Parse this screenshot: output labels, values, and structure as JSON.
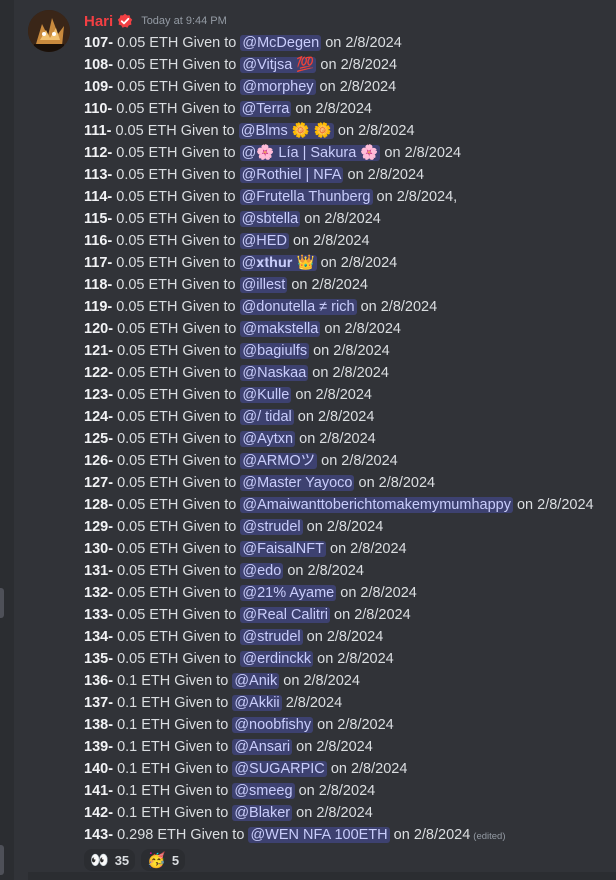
{
  "author": {
    "name": "Hari",
    "timestamp": "Today at 9:44 PM",
    "name_color": "#f23f43",
    "badge": "verified-check-icon"
  },
  "lines": [
    {
      "num": "107-",
      "pre": "0.05 ETH Given to",
      "mention": "@McDegen",
      "post": "on 2/8/2024"
    },
    {
      "num": "108-",
      "pre": "0.05 ETH Given to",
      "mention": "@Vitjsa 💯",
      "post": "on 2/8/2024"
    },
    {
      "num": "109-",
      "pre": "0.05 ETH Given to",
      "mention": "@morphey",
      "post": "on 2/8/2024"
    },
    {
      "num": "110-",
      "pre": "0.05 ETH Given to",
      "mention": "@Terra",
      "post": "on 2/8/2024"
    },
    {
      "num": "111-",
      "pre": "0.05 ETH Given to",
      "mention": "@Blms 🌼 🌼",
      "post": "on 2/8/2024"
    },
    {
      "num": "112-",
      "pre": "0.05 ETH Given to",
      "mention": "@🌸 Lía | Sakura 🌸",
      "post": "on 2/8/2024"
    },
    {
      "num": "113-",
      "pre": "0.05 ETH Given to",
      "mention": "@Rothiel | NFA",
      "post": "on 2/8/2024"
    },
    {
      "num": "114-",
      "pre": "0.05 ETH Given to",
      "mention": "@Frutella Thunberg",
      "post": "on 2/8/2024,"
    },
    {
      "num": "115-",
      "pre": "0.05 ETH Given to",
      "mention": "@sbtella",
      "post": "on 2/8/2024"
    },
    {
      "num": "116-",
      "pre": "0.05 ETH Given to",
      "mention": "@HED",
      "post": "on 2/8/2024"
    },
    {
      "num": "117-",
      "pre": "0.05 ETH Given to",
      "mention": "@𝐱𝐭𝐡𝐮𝐫 👑",
      "post": "on 2/8/2024"
    },
    {
      "num": "118-",
      "pre": "0.05 ETH Given to",
      "mention": "@illest",
      "post": "on 2/8/2024"
    },
    {
      "num": "119-",
      "pre": "0.05 ETH Given to",
      "mention": "@donutella ≠ rich",
      "post": "on 2/8/2024"
    },
    {
      "num": "120-",
      "pre": "0.05 ETH Given to",
      "mention": "@makstella",
      "post": "on 2/8/2024"
    },
    {
      "num": "121-",
      "pre": "0.05 ETH Given to",
      "mention": "@bagiulfs",
      "post": "on 2/8/2024"
    },
    {
      "num": "122-",
      "pre": "0.05 ETH Given to",
      "mention": "@Naskaa",
      "post": "on 2/8/2024"
    },
    {
      "num": "123-",
      "pre": "0.05 ETH Given to",
      "mention": "@Kulle",
      "post": "on 2/8/2024"
    },
    {
      "num": "124-",
      "pre": "0.05 ETH Given to",
      "mention": "@/ tidal",
      "post": "on 2/8/2024"
    },
    {
      "num": "125-",
      "pre": "0.05 ETH Given to",
      "mention": "@Aytxn",
      "post": "on 2/8/2024"
    },
    {
      "num": "126-",
      "pre": "0.05 ETH Given to",
      "mention": "@ARMOツ",
      "post": "on 2/8/2024"
    },
    {
      "num": "127-",
      "pre": "0.05 ETH Given to",
      "mention": "@Master Yayoco",
      "post": "on 2/8/2024"
    },
    {
      "num": "128-",
      "pre": "0.05 ETH Given to",
      "mention": "@Amaiwanttoberichtomakemymumhappy",
      "post": "on 2/8/2024"
    },
    {
      "num": "129-",
      "pre": "0.05 ETH Given to",
      "mention": "@strudel",
      "post": "on 2/8/2024"
    },
    {
      "num": "130-",
      "pre": "0.05 ETH Given to",
      "mention": "@FaisalNFT",
      "post": "on 2/8/2024"
    },
    {
      "num": "131-",
      "pre": "0.05 ETH Given to",
      "mention": "@edo",
      "post": "on 2/8/2024"
    },
    {
      "num": "132-",
      "pre": "0.05 ETH Given to",
      "mention": "@21% Ayame",
      "post": "on 2/8/2024"
    },
    {
      "num": "133-",
      "pre": "0.05 ETH Given to",
      "mention": "@Real Calitri",
      "post": "on 2/8/2024"
    },
    {
      "num": "134-",
      "pre": "0.05 ETH Given to",
      "mention": "@strudel",
      "post": "on 2/8/2024"
    },
    {
      "num": "135-",
      "pre": "0.05 ETH Given to",
      "mention": "@erdinckk",
      "post": "on 2/8/2024"
    },
    {
      "num": "136-",
      "pre": "0.1 ETH Given to",
      "mention": "@Anik",
      "post": "on 2/8/2024"
    },
    {
      "num": "137-",
      "pre": "0.1 ETH Given to",
      "mention": "@Akkii",
      "post": "2/8/2024"
    },
    {
      "num": "138-",
      "pre": "0.1 ETH Given to",
      "mention": "@noobfishy",
      "post": "on 2/8/2024"
    },
    {
      "num": "139-",
      "pre": "0.1 ETH Given to",
      "mention": "@Ansari",
      "post": "on 2/8/2024"
    },
    {
      "num": "140-",
      "pre": "0.1 ETH Given to",
      "mention": "@SUGARPIC",
      "post": "on 2/8/2024"
    },
    {
      "num": "141-",
      "pre": "0.1 ETH Given to",
      "mention": "@smeeg",
      "post": "on 2/8/2024"
    },
    {
      "num": "142-",
      "pre": "0.1 ETH Given to",
      "mention": "@Blaker",
      "post": "on 2/8/2024"
    },
    {
      "num": "143-",
      "pre": "0.298 ETH Given to",
      "mention": "@WEN NFA 100ETH",
      "post": "on 2/8/2024"
    }
  ],
  "edited_label": "(edited)",
  "reactions": [
    {
      "emoji": "👀",
      "count": "35",
      "icon": "eyes-emoji-icon"
    },
    {
      "emoji": "🥳",
      "count": "5",
      "icon": "party-face-emoji-icon"
    }
  ],
  "colors": {
    "background": "#313338",
    "mention_bg": "rgba(88,101,242,0.3)",
    "mention_text": "#c9cdfb",
    "text": "#dbdee1",
    "muted": "#949ba4"
  }
}
